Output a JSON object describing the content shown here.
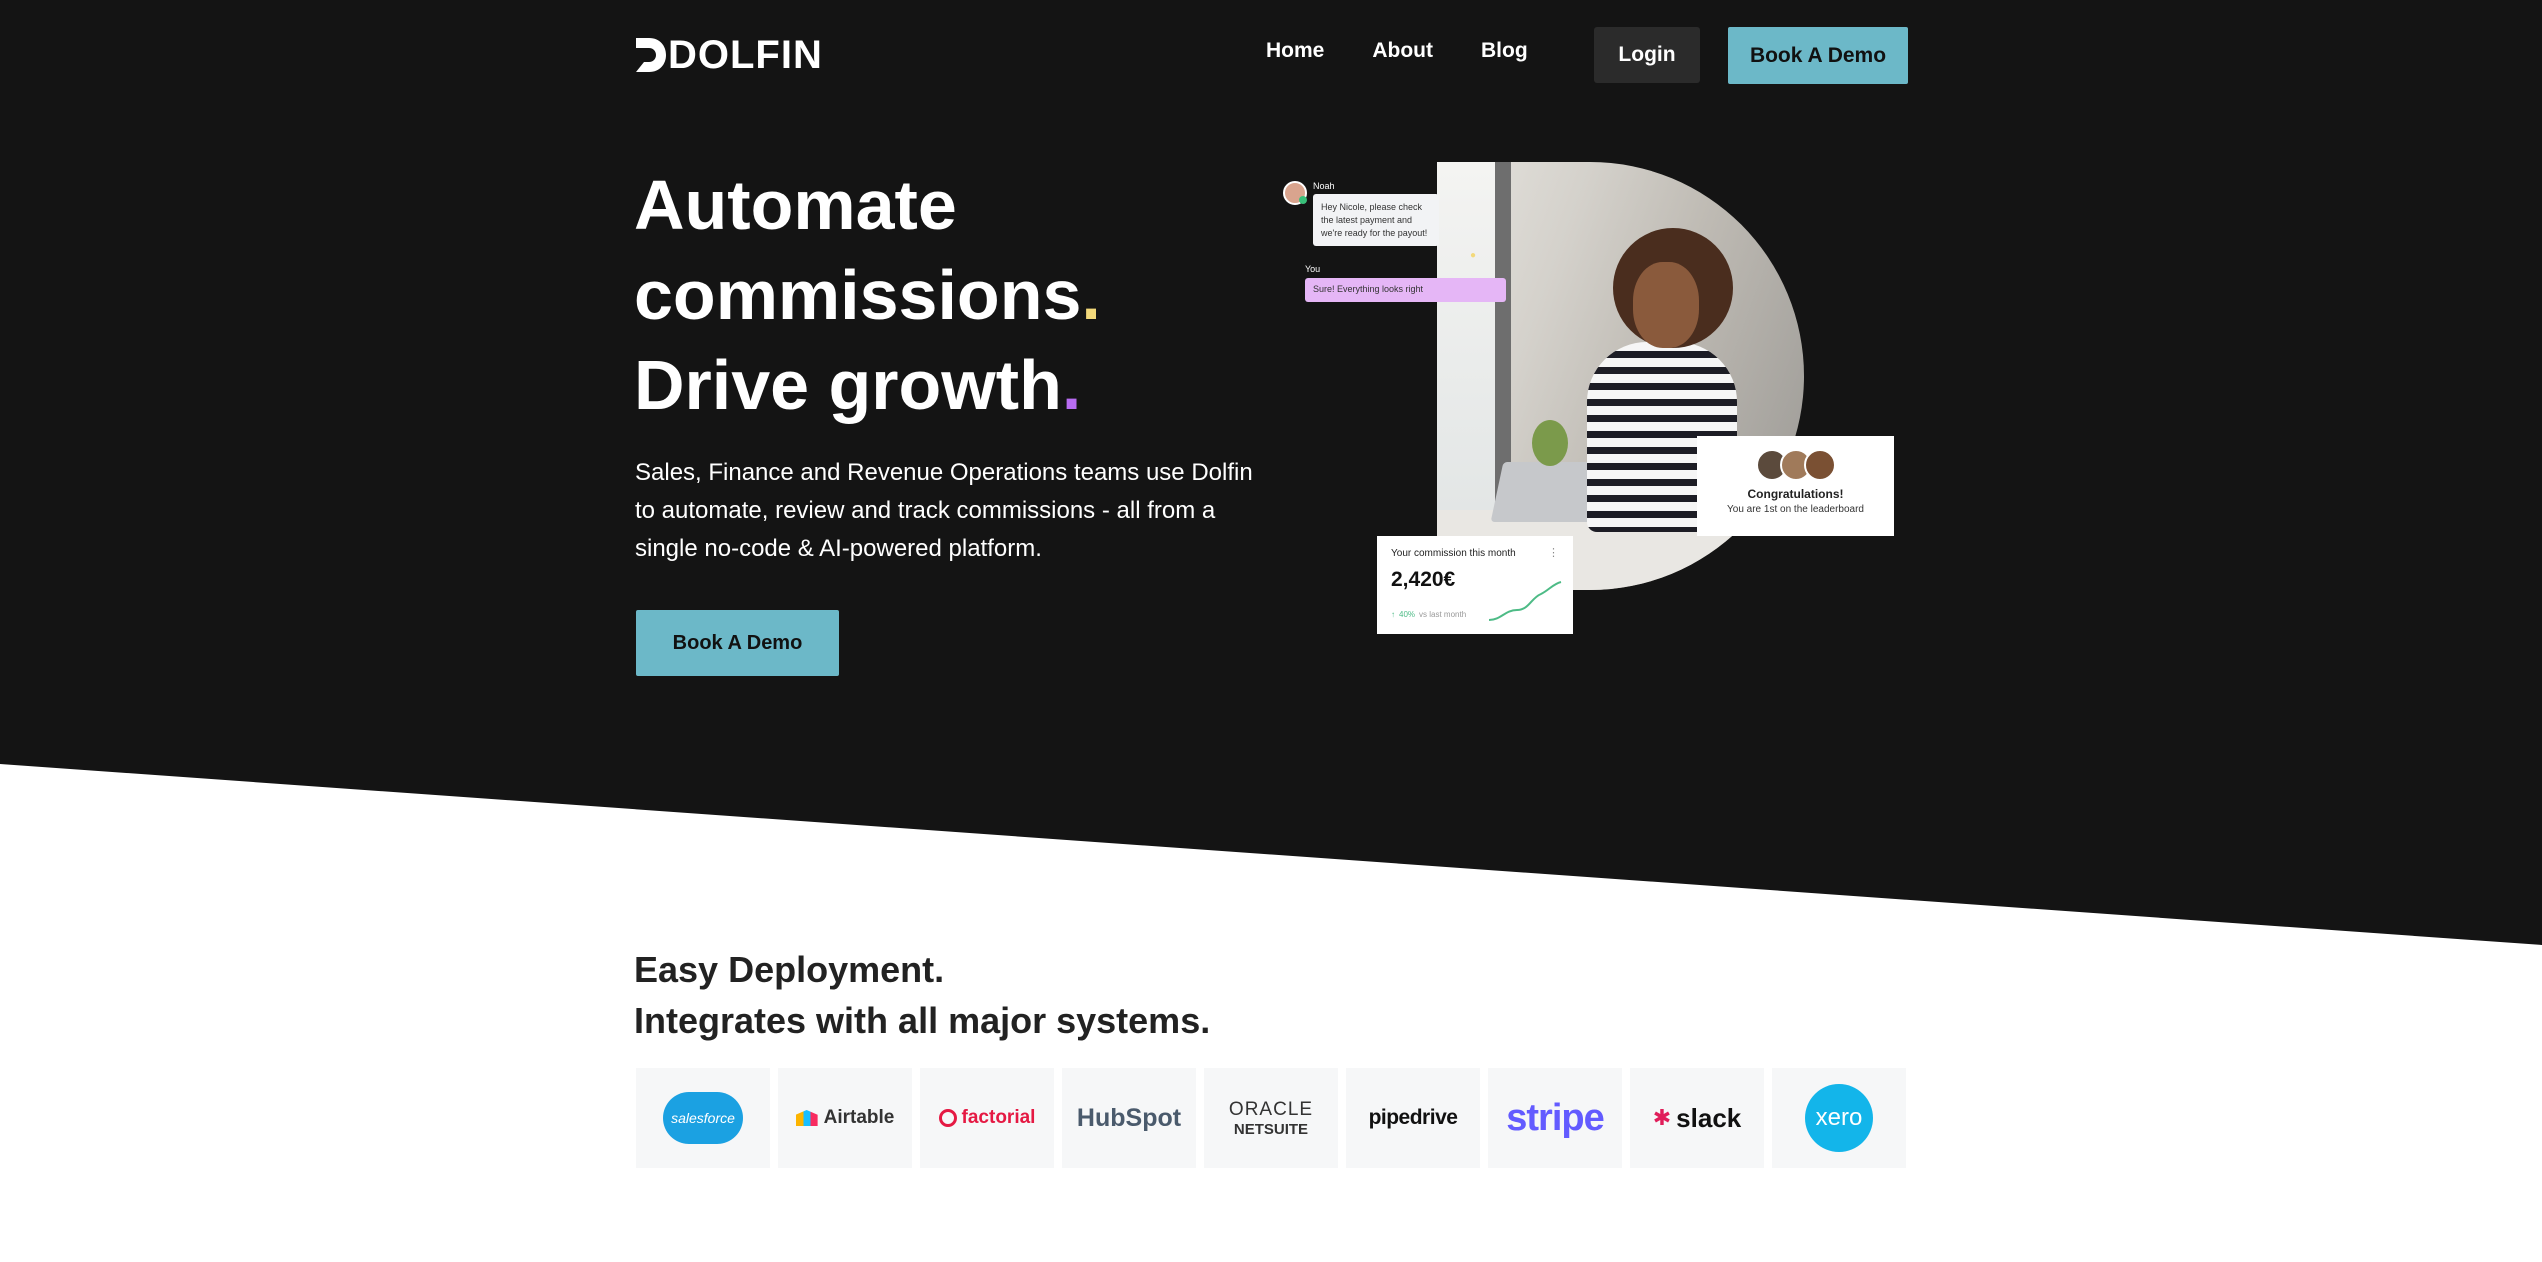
{
  "brand": {
    "name": "DOLFIN"
  },
  "nav": {
    "items": [
      {
        "label": "Home"
      },
      {
        "label": "About"
      },
      {
        "label": "Blog"
      }
    ],
    "login_label": "Login",
    "demo_label": "Book A Demo"
  },
  "hero": {
    "title_line1": "Automate",
    "title_line2": "commissions",
    "title_line3": "Drive growth",
    "dot": ".",
    "subtitle": "Sales, Finance and Revenue Operations teams use Dolfin to automate, review and track commissions - all from a single no-code & AI-powered platform.",
    "cta_label": "Book A Demo"
  },
  "illustration": {
    "chat": {
      "sender_name": "Noah",
      "sender_message": "Hey Nicole, please check the latest payment and we're ready for the payout!",
      "reply_name": "You",
      "reply_message": "Sure! Everything looks right"
    },
    "congrats": {
      "title": "Congratulations!",
      "subtitle": "You are 1st on the leaderboard"
    },
    "commission": {
      "label": "Your commission this month",
      "value": "2,420€",
      "trend": "40%",
      "trend_label": "vs last month"
    }
  },
  "integrations": {
    "title_line1": "Easy Deployment.",
    "title_line2": "Integrates with all major systems.",
    "logos": [
      {
        "name": "salesforce"
      },
      {
        "name": "Airtable"
      },
      {
        "name": "factorial"
      },
      {
        "name": "HubSpot"
      },
      {
        "name": "ORACLE",
        "sub": "NETSUITE"
      },
      {
        "name": "pipedrive"
      },
      {
        "name": "stripe"
      },
      {
        "name": "slack"
      },
      {
        "name": "xero"
      }
    ]
  },
  "colors": {
    "hero_bg": "#141414",
    "accent": "#6cb8c8",
    "dot_yellow": "#f3d97b",
    "dot_purple": "#b86cf2"
  }
}
